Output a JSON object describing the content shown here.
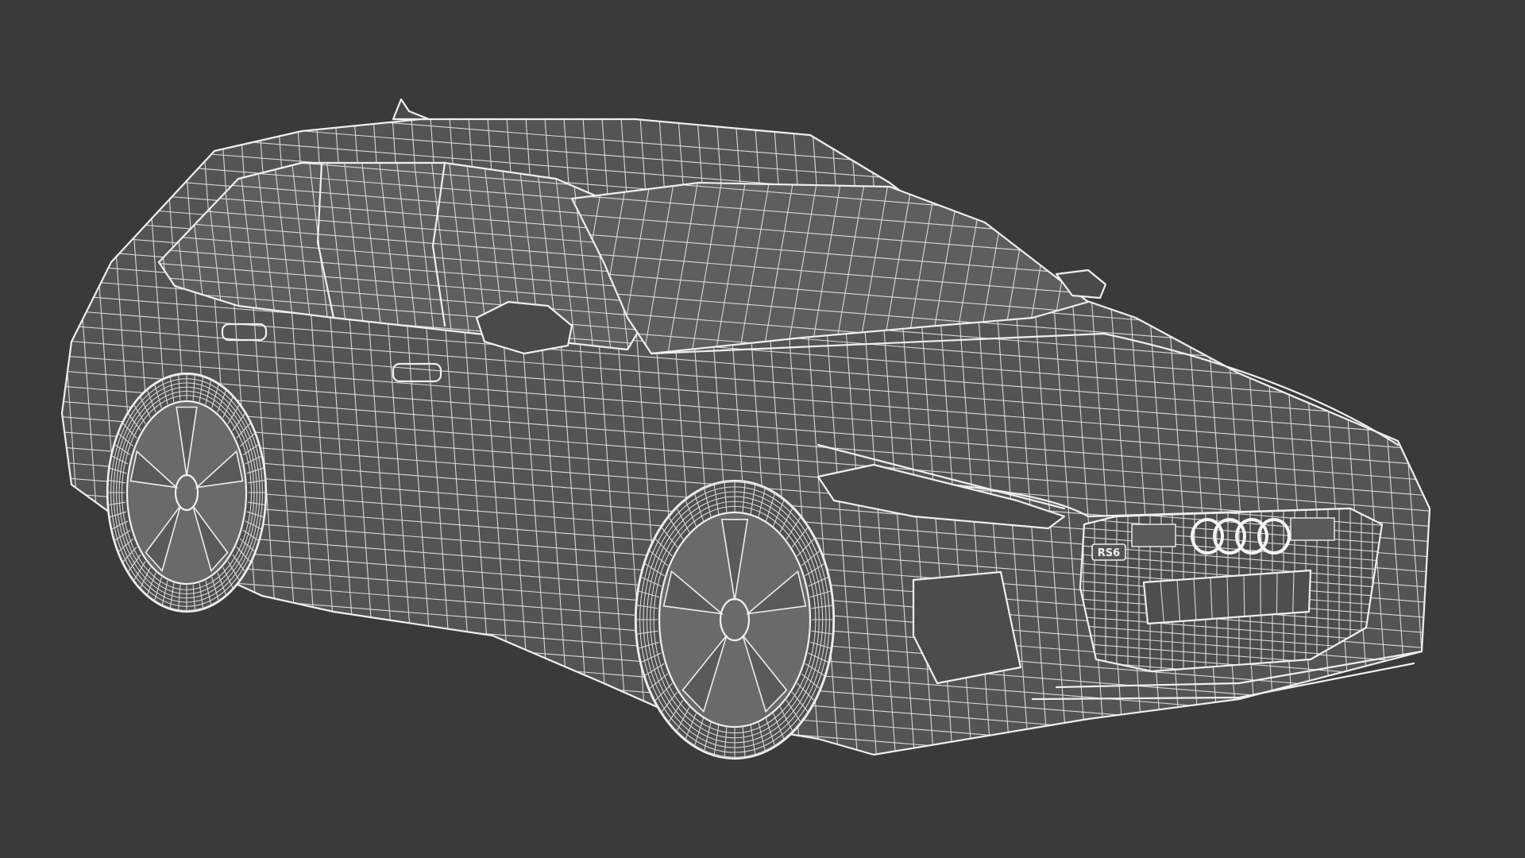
{
  "scene": {
    "subject": "car-wireframe-render",
    "background_color": "#3a3a3a",
    "wire_color": "#d9d9d9",
    "surface_color": "#545454"
  },
  "car": {
    "badge_text": "RS6",
    "logo_rings": 4,
    "wheels_visible": 2,
    "spokes_per_wheel": 5
  }
}
